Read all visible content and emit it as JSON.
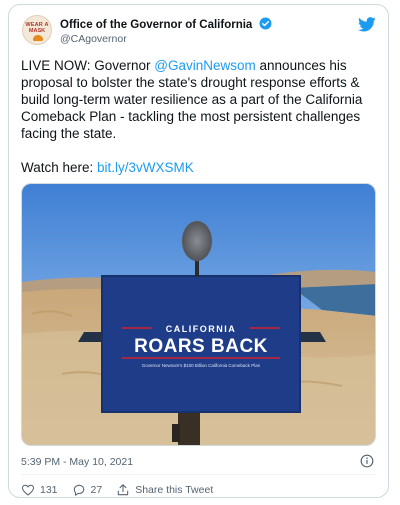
{
  "author": {
    "display_name": "Office of the Governor of California",
    "handle": "@CAgovernor",
    "avatar_text_line1": "WEAR A",
    "avatar_text_line2": "MASK"
  },
  "tweet": {
    "text_prefix": "LIVE NOW: Governor ",
    "mention": "@GavinNewsom",
    "text_suffix": " announces his proposal to bolster the state's drought response efforts & build long-term water resilience as a part of the California Comeback Plan - tackling the most persistent challenges facing the state.",
    "watch_label": "Watch here: ",
    "watch_link": "bit.ly/3vWXSMK"
  },
  "media": {
    "sign_line1": "CALIFORNIA",
    "sign_line2": "ROARS BACK",
    "sign_line3": "Governor Newsom's $100 Billion California Comeback Plan"
  },
  "meta": {
    "timestamp": "5:39 PM - May 10, 2021"
  },
  "actions": {
    "likes": "131",
    "replies": "27",
    "share_label": "Share this Tweet"
  },
  "colors": {
    "accent": "#1d9bf0",
    "sign_blue": "#1f3c88",
    "sign_red": "#d0212f"
  },
  "icons": [
    "verified-badge-icon",
    "twitter-bird-icon",
    "info-icon",
    "heart-icon",
    "reply-icon",
    "share-icon"
  ]
}
